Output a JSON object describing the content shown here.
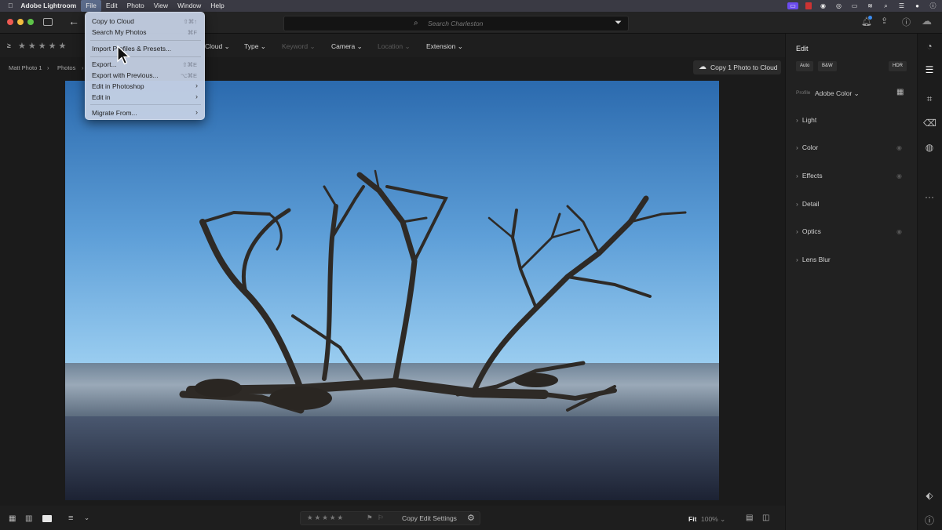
{
  "menubar": {
    "app_name": "Adobe Lightroom",
    "items": [
      "File",
      "Edit",
      "Photo",
      "View",
      "Window",
      "Help"
    ]
  },
  "search": {
    "placeholder": "Search Charleston"
  },
  "filters": {
    "cloud": "Cloud",
    "type": "Type",
    "keyword": "Keyword",
    "camera": "Camera",
    "location": "Location",
    "extension": "Extension"
  },
  "breadcrumb": {
    "root": "Matt Photo 1",
    "folder": "Photos"
  },
  "cloud_button": {
    "label": "Copy 1 Photo to Cloud"
  },
  "file_menu": {
    "items": [
      {
        "label": "Copy to Cloud",
        "shortcut": "⇧⌘↑"
      },
      {
        "label": "Search My Photos",
        "shortcut": "⌘F"
      },
      {
        "label": "Import Profiles & Presets...",
        "shortcut": ""
      },
      {
        "label": "Export...",
        "shortcut": "⇧⌘E"
      },
      {
        "label": "Export with Previous...",
        "shortcut": "⌥⌘E"
      },
      {
        "label": "Edit in Photoshop",
        "shortcut": ""
      },
      {
        "label": "Edit in",
        "shortcut": ""
      },
      {
        "label": "Migrate From...",
        "shortcut": ""
      }
    ]
  },
  "edit_panel": {
    "title": "Edit",
    "auto": "Auto",
    "bw": "B&W",
    "hdr": "HDR",
    "profile_label": "Profile",
    "profile_value": "Adobe Color",
    "sections": [
      "Light",
      "Color",
      "Effects",
      "Detail",
      "Optics",
      "Lens Blur"
    ]
  },
  "bottom_bar": {
    "copy_edit": "Copy Edit Settings",
    "fit": "Fit",
    "zoom": "100%"
  },
  "colors": {
    "menubar": "#3a3a44",
    "panel": "#212121",
    "sky_top": "#2f6fb3",
    "sky_bottom": "#8cc4ec",
    "menu_bg": "#c4d0e4"
  }
}
